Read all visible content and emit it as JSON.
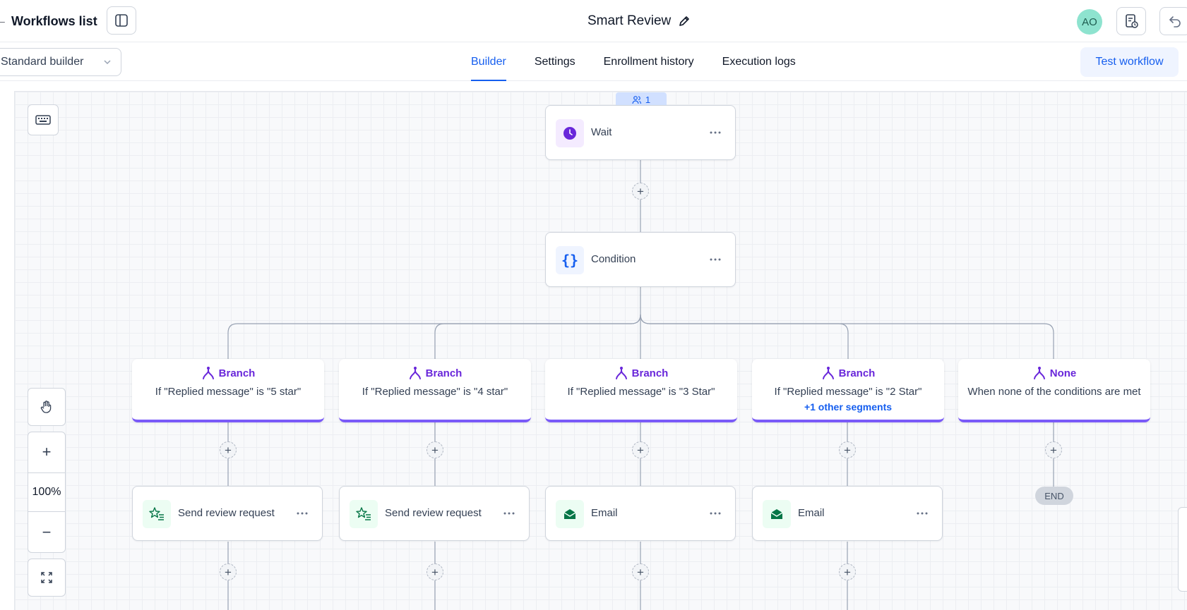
{
  "header": {
    "back_label": "Workflows list",
    "workflow_title": "Smart Review",
    "avatar_initials": "AO"
  },
  "subbar": {
    "builder_select": "Standard builder",
    "tabs": [
      {
        "label": "Builder",
        "active": true
      },
      {
        "label": "Settings",
        "active": false
      },
      {
        "label": "Enrollment history",
        "active": false
      },
      {
        "label": "Execution logs",
        "active": false
      }
    ],
    "test_button": "Test workflow"
  },
  "canvas": {
    "zoom_level": "100%",
    "enrolled_count": "1",
    "nodes": {
      "wait": {
        "label": "Wait",
        "icon": "clock-icon"
      },
      "condition": {
        "label": "Condition",
        "icon": "braces-icon"
      }
    },
    "branches": [
      {
        "title": "Branch",
        "description": "If \"Replied message\" is \"5 star\"",
        "extra": ""
      },
      {
        "title": "Branch",
        "description": "If \"Replied message\" is \"4 star\"",
        "extra": ""
      },
      {
        "title": "Branch",
        "description": "If \"Replied message\" is \"3 Star\"",
        "extra": ""
      },
      {
        "title": "Branch",
        "description": "If \"Replied message\" is \"2 Star\"",
        "extra": "+1 other segments"
      },
      {
        "title": "None",
        "description": "When none of the conditions are met",
        "extra": ""
      }
    ],
    "actions": [
      {
        "label": "Send review request",
        "icon": "review-star-icon"
      },
      {
        "label": "Send review request",
        "icon": "review-star-icon"
      },
      {
        "label": "Email",
        "icon": "email-icon"
      },
      {
        "label": "Email",
        "icon": "email-icon"
      }
    ],
    "end_label": "END"
  },
  "colors": {
    "accent_blue": "#155eef",
    "branch_purple": "#7a5af8",
    "wait_icon_bg": "#f4ebff",
    "condition_icon_bg": "#eff4ff",
    "action_icon_bg": "#ecfdf3",
    "action_icon_fg": "#067647"
  }
}
